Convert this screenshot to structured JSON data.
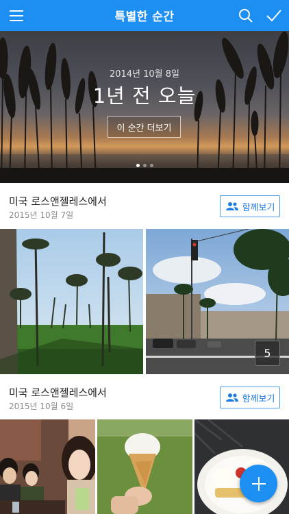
{
  "header": {
    "title": "특별한 순간",
    "menu_icon": "menu-icon",
    "search_icon": "search-icon",
    "check_icon": "check-icon",
    "color": "#1e8ff2"
  },
  "hero": {
    "date": "2014년 10월 8일",
    "headline": "1년 전 오늘",
    "more_button": "이 순간 더보기",
    "page_count": 3,
    "active_page": 1
  },
  "moments": [
    {
      "place": "미국 로스앤젤레스에서",
      "date": "2015년 10월 7일",
      "share_button": "함께보기",
      "more_count": "5"
    },
    {
      "place": "미국 로스앤젤레스에서",
      "date": "2015년 10월 6일",
      "share_button": "함께보기"
    }
  ],
  "fab": {
    "icon": "plus-icon"
  }
}
